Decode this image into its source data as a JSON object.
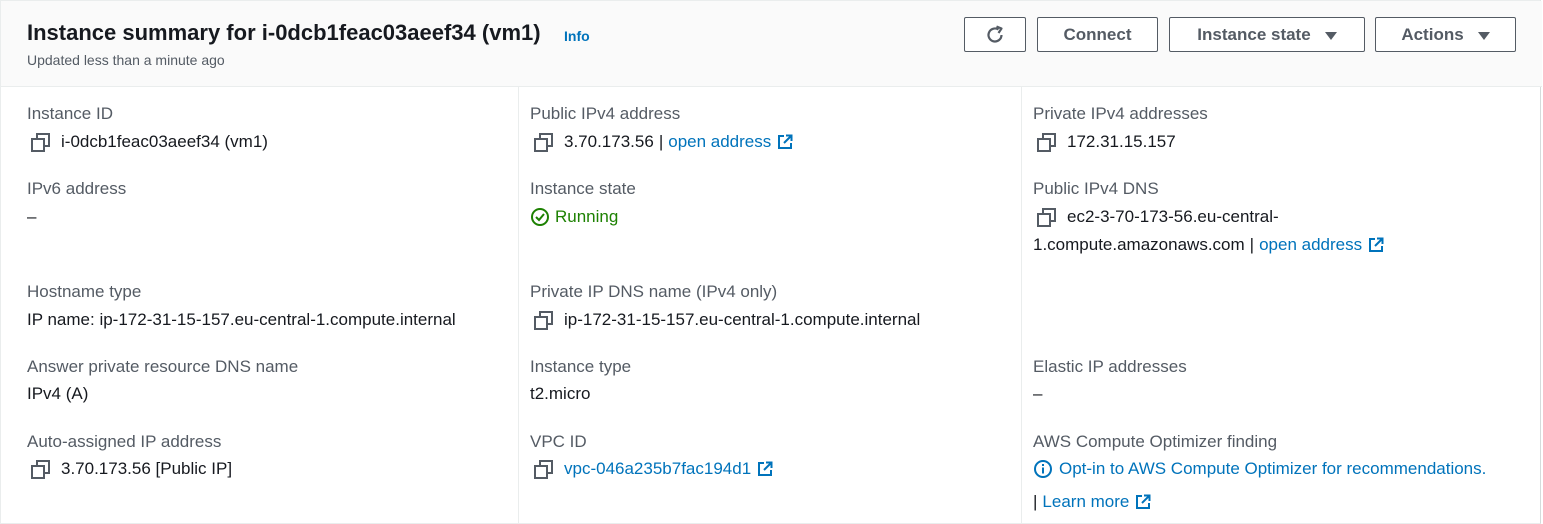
{
  "header": {
    "title": "Instance summary for i-0dcb1feac03aeef34 (vm1)",
    "info": "Info",
    "subtitle": "Updated less than a minute ago",
    "buttons": {
      "connect": "Connect",
      "instance_state": "Instance state",
      "actions": "Actions"
    }
  },
  "fields": {
    "instance_id": {
      "label": "Instance ID",
      "value": "i-0dcb1feac03aeef34 (vm1)"
    },
    "public_ipv4": {
      "label": "Public IPv4 address",
      "value": "3.70.173.56",
      "link": "open address"
    },
    "private_ipv4": {
      "label": "Private IPv4 addresses",
      "value": "172.31.15.157"
    },
    "ipv6": {
      "label": "IPv6 address",
      "value": "–"
    },
    "instance_state": {
      "label": "Instance state",
      "value": "Running"
    },
    "public_dns": {
      "label": "Public IPv4 DNS",
      "value_line1": "ec2-3-70-173-56.eu-central-",
      "value_line2": "1.compute.amazonaws.com",
      "link": "open address"
    },
    "hostname_type": {
      "label": "Hostname type",
      "value": "IP name: ip-172-31-15-157.eu-central-1.compute.internal"
    },
    "private_dns": {
      "label": "Private IP DNS name (IPv4 only)",
      "value": "ip-172-31-15-157.eu-central-1.compute.internal"
    },
    "answer_dns": {
      "label": "Answer private resource DNS name",
      "value": "IPv4 (A)"
    },
    "instance_type": {
      "label": "Instance type",
      "value": "t2.micro"
    },
    "elastic_ip": {
      "label": "Elastic IP addresses",
      "value": "–"
    },
    "auto_ip": {
      "label": "Auto-assigned IP address",
      "value": "3.70.173.56 [Public IP]"
    },
    "vpc_id": {
      "label": "VPC ID",
      "value": "vpc-046a235b7fac194d1"
    },
    "optimizer": {
      "label": "AWS Compute Optimizer finding",
      "value": "Opt-in to AWS Compute Optimizer for recommendations.",
      "learn_more": "Learn more"
    }
  },
  "colors": {
    "link": "#0073bb",
    "success": "#1d8102",
    "label": "#545b64",
    "text": "#16191f"
  },
  "icons": [
    "refresh-icon",
    "caret-down-icon",
    "copy-icon",
    "external-link-icon",
    "status-check-icon",
    "info-circle-icon"
  ]
}
